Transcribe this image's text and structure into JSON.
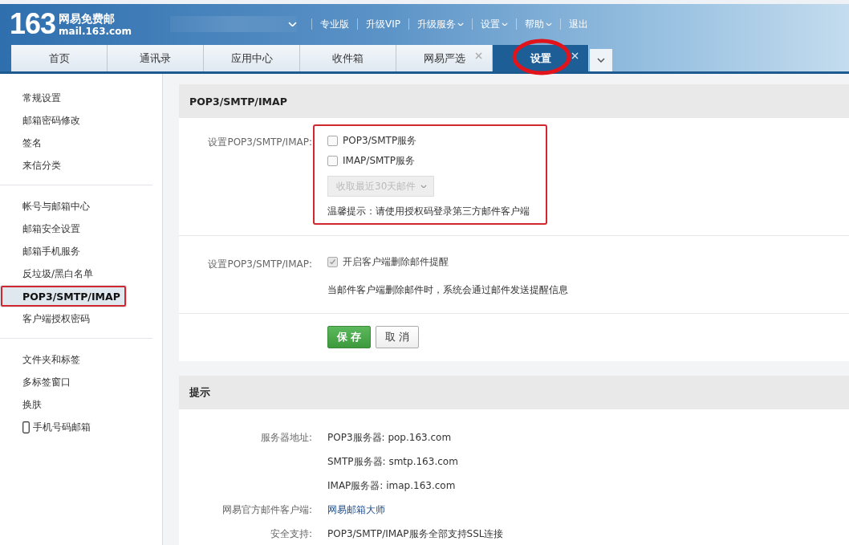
{
  "logo": {
    "number": "163",
    "name": "网易免费邮",
    "domain": "mail.163.com"
  },
  "top_links": [
    {
      "label": "专业版",
      "dropdown": false
    },
    {
      "label": "升级VIP",
      "dropdown": false
    },
    {
      "label": "升级服务",
      "dropdown": true
    },
    {
      "label": "设置",
      "dropdown": true
    },
    {
      "label": "帮助",
      "dropdown": true
    },
    {
      "label": "退出",
      "dropdown": false
    }
  ],
  "tabs": [
    {
      "label": "首页",
      "selected": false,
      "closable": false,
      "highlighted": false
    },
    {
      "label": "通讯录",
      "selected": false,
      "closable": false,
      "highlighted": false
    },
    {
      "label": "应用中心",
      "selected": false,
      "closable": false,
      "highlighted": false
    },
    {
      "label": "收件箱",
      "selected": false,
      "closable": false,
      "highlighted": false
    },
    {
      "label": "网易严选",
      "selected": false,
      "closable": true,
      "highlighted": false
    },
    {
      "label": "设置",
      "selected": true,
      "closable": true,
      "highlighted": true
    }
  ],
  "sidebar": {
    "groups": [
      {
        "items": [
          {
            "label": "常规设置",
            "kind": "text",
            "selected": false,
            "highlighted": false
          },
          {
            "label": "邮箱密码修改",
            "kind": "text",
            "selected": false,
            "highlighted": false
          },
          {
            "label": "签名",
            "kind": "text",
            "selected": false,
            "highlighted": false
          },
          {
            "label": "来信分类",
            "kind": "text",
            "selected": false,
            "highlighted": false
          }
        ]
      },
      {
        "items": [
          {
            "label": "帐号与邮箱中心",
            "kind": "text",
            "selected": false,
            "highlighted": false
          },
          {
            "label": "邮箱安全设置",
            "kind": "text",
            "selected": false,
            "highlighted": false
          },
          {
            "label": "邮箱手机服务",
            "kind": "text",
            "selected": false,
            "highlighted": false
          },
          {
            "label": "反垃圾/黑白名单",
            "kind": "text",
            "selected": false,
            "highlighted": false
          },
          {
            "label": "POP3/SMTP/IMAP",
            "kind": "text",
            "selected": true,
            "highlighted": true
          },
          {
            "label": "客户端授权密码",
            "kind": "text",
            "selected": false,
            "highlighted": false
          }
        ]
      },
      {
        "items": [
          {
            "label": "文件夹和标签",
            "kind": "text",
            "selected": false,
            "highlighted": false
          },
          {
            "label": "多标签窗口",
            "kind": "text",
            "selected": false,
            "highlighted": false
          },
          {
            "label": "换肤",
            "kind": "text",
            "selected": false,
            "highlighted": false
          },
          {
            "label": "手机号码邮箱",
            "kind": "phone",
            "selected": false,
            "highlighted": false
          }
        ]
      }
    ]
  },
  "settings_panel": {
    "title": "POP3/SMTP/IMAP",
    "rows": [
      {
        "label": "设置POP3/SMTP/IMAP:",
        "highlighted": true,
        "options": [
          {
            "label": "POP3/SMTP服务",
            "checked": false,
            "disabled": false
          },
          {
            "label": "IMAP/SMTP服务",
            "checked": false,
            "disabled": false
          }
        ],
        "select": {
          "value": "收取最近30天邮件",
          "disabled": true
        },
        "note": "温馨提示：请使用授权码登录第三方邮件客户端"
      },
      {
        "label": "设置POP3/SMTP/IMAP:",
        "highlighted": false,
        "options": [
          {
            "label": "开启客户端删除邮件提醒",
            "checked": true,
            "disabled": true
          }
        ],
        "note": "当邮件客户端删除邮件时，系统会通过邮件发送提醒信息"
      }
    ],
    "buttons": [
      {
        "label": "保 存",
        "kind": "primary"
      },
      {
        "label": "取 消",
        "kind": "secondary"
      }
    ]
  },
  "tips_panel": {
    "title": "提示",
    "rows": [
      {
        "label": "服务器地址:",
        "values": [
          {
            "text": "POP3服务器: pop.163.com",
            "kind": "text"
          },
          {
            "text": "SMTP服务器: smtp.163.com",
            "kind": "text"
          },
          {
            "text": "IMAP服务器: imap.163.com",
            "kind": "text"
          }
        ]
      },
      {
        "label": "网易官方邮件客户端:",
        "values": [
          {
            "text": "网易邮箱大师",
            "kind": "link"
          }
        ]
      },
      {
        "label": "安全支持:",
        "values": [
          {
            "text": "POP3/SMTP/IMAP服务全部支持SSL连接",
            "kind": "text"
          }
        ]
      }
    ]
  }
}
